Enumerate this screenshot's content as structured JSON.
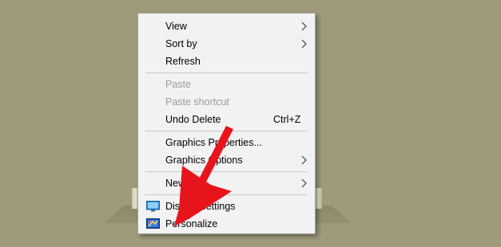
{
  "menu": {
    "items": [
      {
        "label": "View"
      },
      {
        "label": "Sort by"
      },
      {
        "label": "Refresh"
      },
      {
        "label": "Paste"
      },
      {
        "label": "Paste shortcut"
      },
      {
        "label": "Undo Delete",
        "shortcut": "Ctrl+Z"
      },
      {
        "label": "Graphics Properties..."
      },
      {
        "label": "Graphics Options"
      },
      {
        "label": "New"
      },
      {
        "label": "Display settings"
      },
      {
        "label": "Personalize"
      }
    ]
  },
  "icons": {
    "display": "display-settings-icon",
    "personalize": "personalize-icon",
    "submenu": "chevron-right-icon"
  },
  "colors": {
    "desktop": "#a09a7c",
    "menu_bg": "#f2f2f2",
    "disabled_text": "#9a9a9a",
    "annotation_arrow": "#e8141c"
  }
}
